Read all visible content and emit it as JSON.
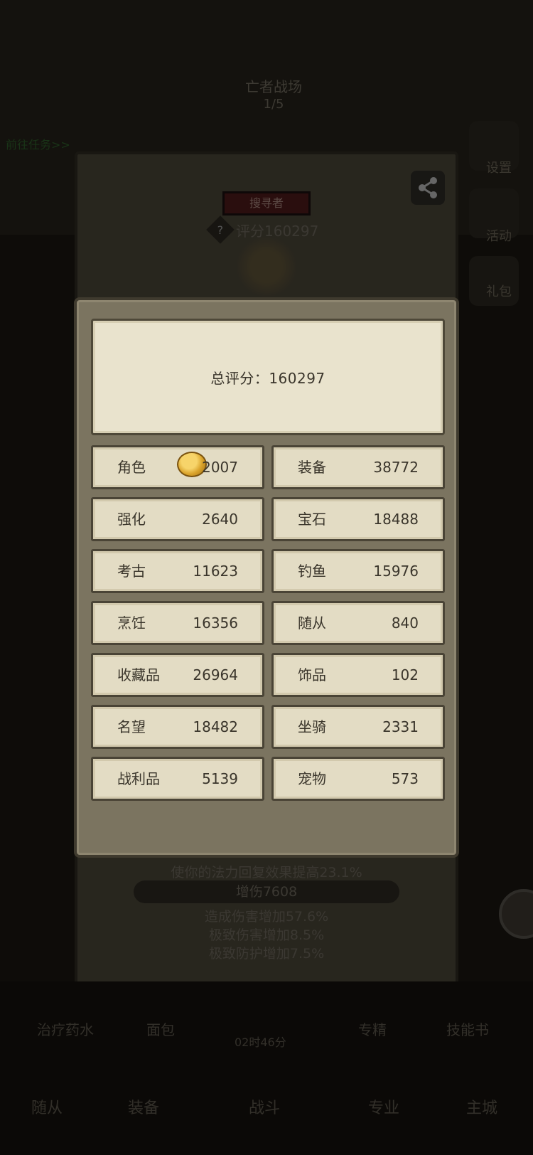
{
  "background": {
    "top_title": "亡者战场",
    "top_sub": "1/5",
    "quest_link": "前往任务>>",
    "right_menu": [
      "设置",
      "活动",
      "礼包"
    ],
    "rank_badge": "搜寻者",
    "score_line": "评分160297",
    "stats": {
      "mana": "使你的法力回复效果提高23.1%",
      "damage_bar": "增伤7608",
      "dmg_inc": "造成伤害增加57.6%",
      "extreme_dmg": "极致伤害增加8.5%",
      "extreme_def": "极致防护增加7.5%"
    },
    "bottom_items": [
      "治疗药水",
      "面包",
      "专精",
      "技能书"
    ],
    "timer": "02时46分",
    "nav": [
      "随从",
      "装备",
      "战斗",
      "专业",
      "主城"
    ]
  },
  "modal": {
    "total_label": "总评分：",
    "total_value": "160297",
    "rows": [
      {
        "left": {
          "label": "角色",
          "value": "2007"
        },
        "right": {
          "label": "装备",
          "value": "38772"
        }
      },
      {
        "left": {
          "label": "强化",
          "value": "2640"
        },
        "right": {
          "label": "宝石",
          "value": "18488"
        }
      },
      {
        "left": {
          "label": "考古",
          "value": "11623"
        },
        "right": {
          "label": "钓鱼",
          "value": "15976"
        }
      },
      {
        "left": {
          "label": "烹饪",
          "value": "16356"
        },
        "right": {
          "label": "随从",
          "value": "840"
        }
      },
      {
        "left": {
          "label": "收藏品",
          "value": "26964"
        },
        "right": {
          "label": "饰品",
          "value": "102"
        }
      },
      {
        "left": {
          "label": "名望",
          "value": "18482"
        },
        "right": {
          "label": "坐骑",
          "value": "2331"
        }
      },
      {
        "left": {
          "label": "战利品",
          "value": "5139"
        },
        "right": {
          "label": "宠物",
          "value": "573"
        }
      }
    ]
  },
  "colors": {
    "panel": "#7b7460",
    "card": "#e3dcc4",
    "text": "#3a352b"
  }
}
